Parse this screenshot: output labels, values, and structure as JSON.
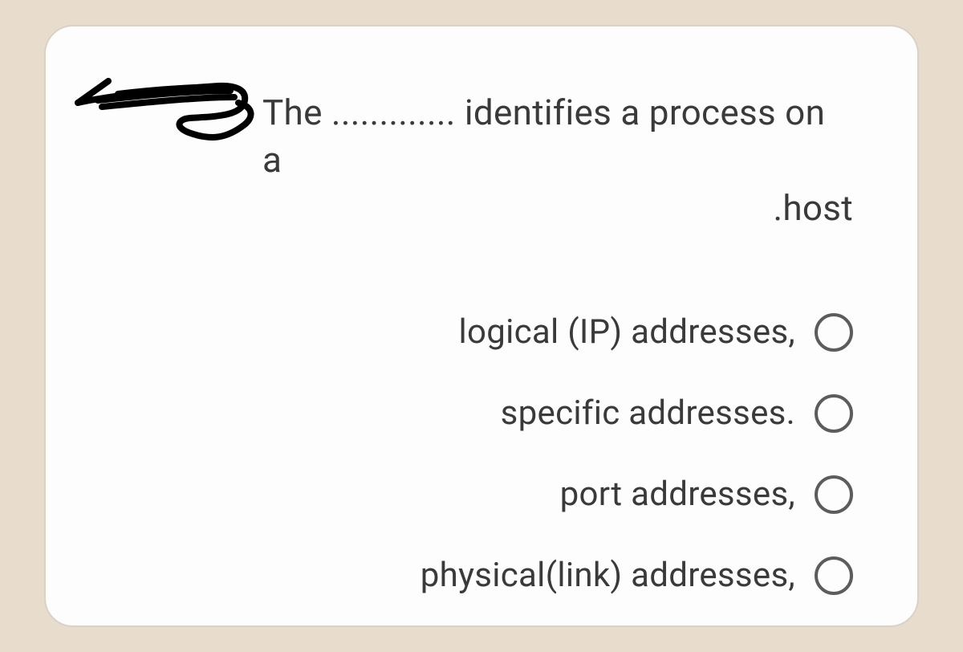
{
  "question": {
    "line1": "The ............. identifies a process on a",
    "line2": ".host"
  },
  "options": [
    {
      "label": "logical (IP) addresses,"
    },
    {
      "label": "specific addresses."
    },
    {
      "label": "port addresses,"
    },
    {
      "label": "physical(link) addresses,"
    }
  ]
}
